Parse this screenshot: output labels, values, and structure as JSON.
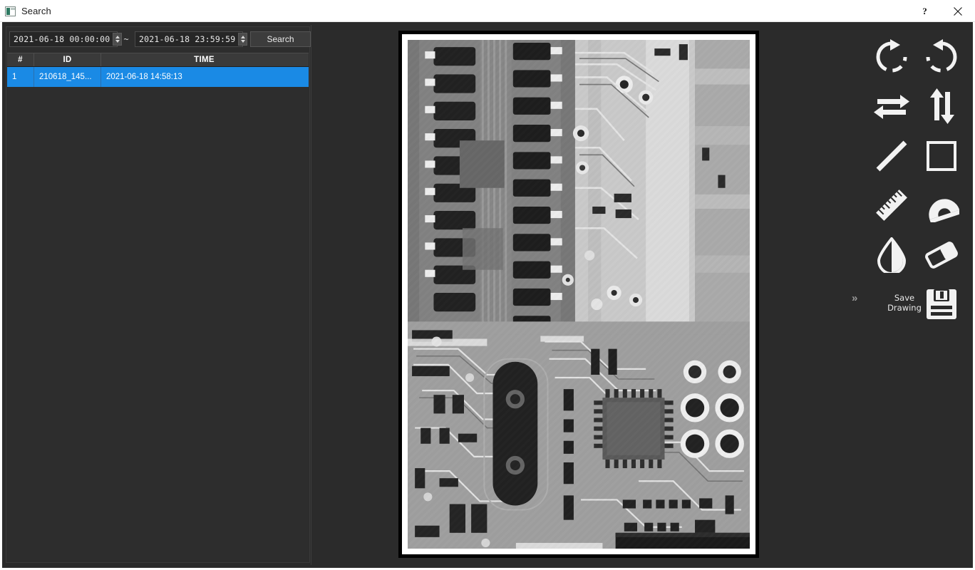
{
  "window": {
    "title": "Search",
    "app_icon": "app-window-icon",
    "help_label": "?",
    "close_label": "✕"
  },
  "search_panel": {
    "from_datetime": "2021-06-18 00:00:00",
    "to_datetime": "2021-06-18 23:59:59",
    "range_separator": "~",
    "search_button": "Search",
    "table": {
      "columns": [
        "#",
        "ID",
        "TIME"
      ],
      "rows": [
        {
          "num": "1",
          "id": "210618_145...",
          "time": "2021-06-18 14:58:13",
          "selected": true
        }
      ]
    }
  },
  "viewer": {
    "image_type": "pcb-xray-image",
    "frame_border_color": "#000000",
    "background_color": "#2b2b2b"
  },
  "toolbar": {
    "background_color": "#2b2b2b",
    "icon_color": "#f2f2f2",
    "tools": [
      {
        "name": "rotate-clockwise-icon",
        "label": "Rotate Clockwise"
      },
      {
        "name": "rotate-counterclockwise-icon",
        "label": "Rotate Counter-Clockwise"
      },
      {
        "name": "flip-horizontal-icon",
        "label": "Flip Horizontal"
      },
      {
        "name": "flip-vertical-icon",
        "label": "Flip Vertical"
      },
      {
        "name": "line-tool-icon",
        "label": "Line"
      },
      {
        "name": "rectangle-tool-icon",
        "label": "Rectangle"
      },
      {
        "name": "ruler-tool-icon",
        "label": "Ruler"
      },
      {
        "name": "protractor-tool-icon",
        "label": "Protractor"
      },
      {
        "name": "contrast-tool-icon",
        "label": "Contrast"
      },
      {
        "name": "eraser-tool-icon",
        "label": "Eraser"
      },
      {
        "name": "save-drawing-icon",
        "label": "Save Drawing"
      }
    ],
    "save_drawing_label_line1": "Save",
    "save_drawing_label_line2": "Drawing",
    "expand_chevron": "»",
    "selection_color": "#1a8ae5"
  }
}
